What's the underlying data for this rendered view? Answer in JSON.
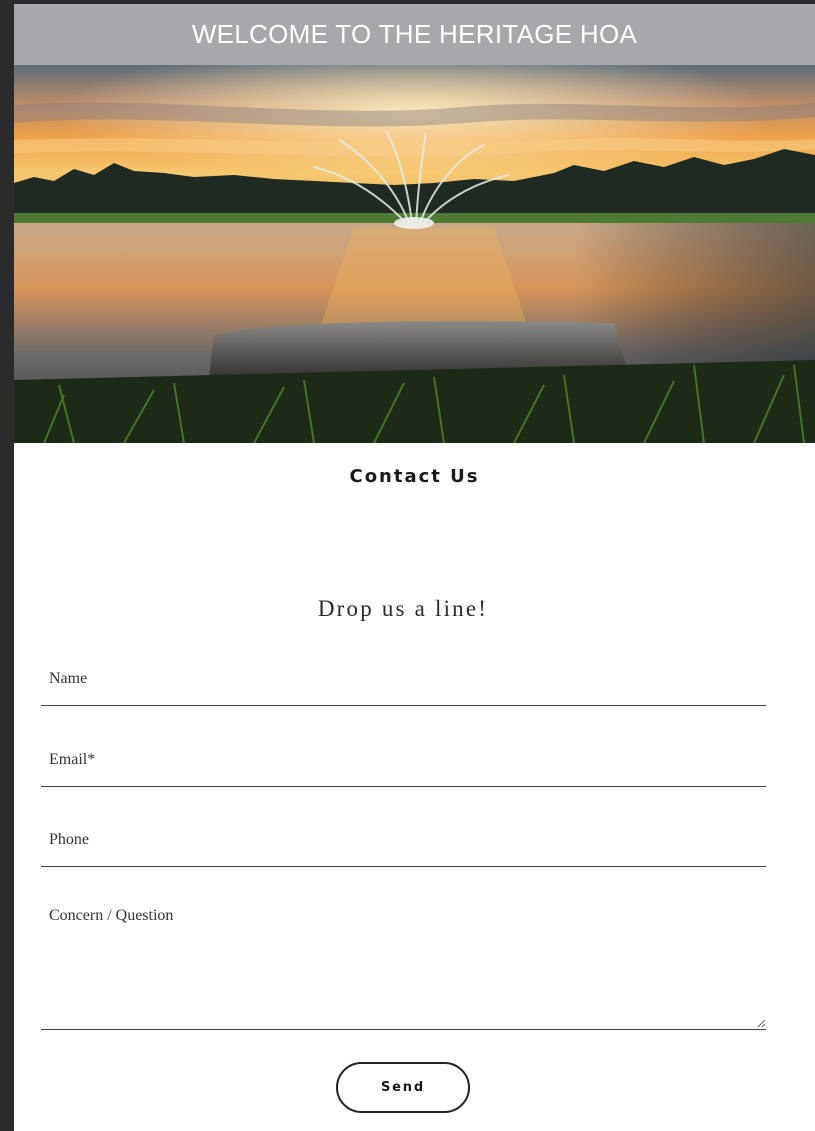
{
  "header": {
    "title": "WELCOME TO THE HERITAGE HOA"
  },
  "hero": {
    "image": "sunset-pond-fountain-photo"
  },
  "contact": {
    "heading": "Contact Us",
    "subheading": "Drop us a line!",
    "fields": {
      "name": {
        "label": "Name"
      },
      "email": {
        "label": "Email*"
      },
      "phone": {
        "label": "Phone"
      },
      "message": {
        "label": "Concern / Question"
      }
    },
    "send_label": "Send"
  },
  "colors": {
    "banner_bg": "#a6a8ab",
    "banner_text": "#ffffff",
    "page_bg": "#ffffff",
    "frame_bg": "#2b2b2b",
    "field_border": "#444444"
  }
}
